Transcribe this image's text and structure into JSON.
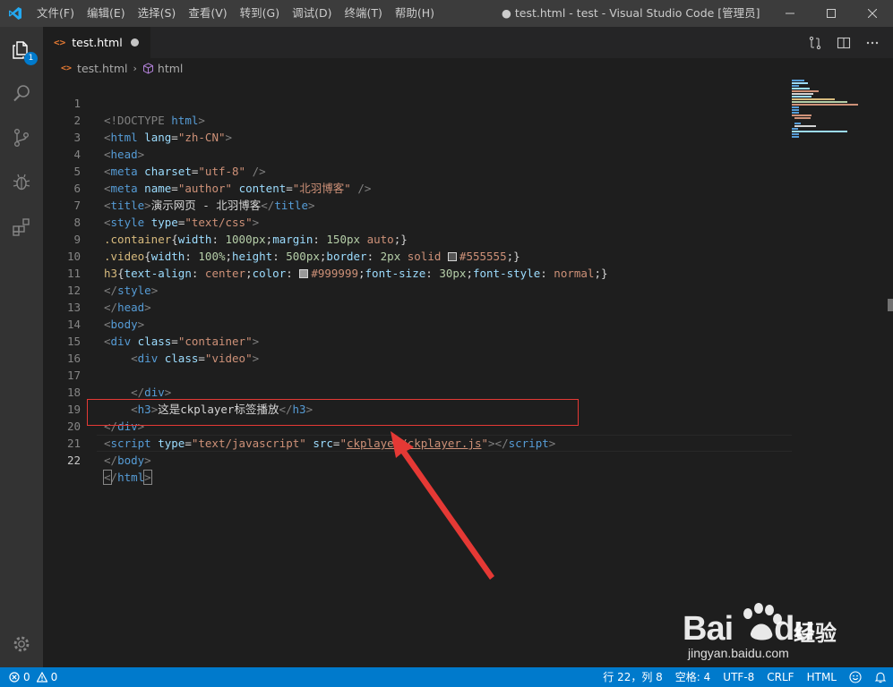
{
  "titlebar": {
    "menu": [
      "文件(F)",
      "编辑(E)",
      "选择(S)",
      "查看(V)",
      "转到(G)",
      "调试(D)",
      "终端(T)",
      "帮助(H)"
    ],
    "window_title": "● test.html - test - Visual Studio Code [管理员]"
  },
  "activitybar": {
    "explorer_badge": "1"
  },
  "tab": {
    "icon": "<>",
    "label": "test.html"
  },
  "breadcrumb": {
    "file_icon": "<>",
    "file": "test.html",
    "element": "html"
  },
  "editor": {
    "line_numbers": [
      "1",
      "2",
      "3",
      "4",
      "5",
      "6",
      "7",
      "8",
      "9",
      "10",
      "11",
      "12",
      "13",
      "14",
      "15",
      "16",
      "17",
      "18",
      "19",
      "20",
      "21",
      "22"
    ],
    "active_line": "22",
    "code": {
      "l1_a": "<!DOCTYPE ",
      "l1_b": "html",
      "l1_c": ">",
      "l2_tag": "html",
      "l2_attr": "lang",
      "l2_val": "\"zh-CN\"",
      "l3_tag": "head",
      "l4_tag": "meta",
      "l4_attr": "charset",
      "l4_val": "\"utf-8\"",
      "l5_tag": "meta",
      "l5_attr1": "name",
      "l5_val1": "\"author\"",
      "l5_attr2": "content",
      "l5_val2": "\"北羽博客\"",
      "l6_tag": "title",
      "l6_text": "演示网页 - 北羽博客",
      "l6_end": "title",
      "l7_tag": "style",
      "l7_attr": "type",
      "l7_val": "\"text/css\"",
      "l8_sel": ".container",
      "l8_p1": "width",
      "l8_v1": "1000px",
      "l8_p2": "margin",
      "l8_v2": "150px",
      "l8_v3": "auto",
      "l9_sel": ".video",
      "l9_p1": "width",
      "l9_v1": "100%",
      "l9_p2": "height",
      "l9_v2": "500px",
      "l9_p3": "border",
      "l9_v3": "2px",
      "l9_v4": "solid",
      "l9_v5": "#555555",
      "l10_sel": "h3",
      "l10_p1": "text-align",
      "l10_v1": "center",
      "l10_p2": "color",
      "l10_v2": "#999999",
      "l10_p3": "font-size",
      "l10_v3": "30px",
      "l10_p4": "font-style",
      "l10_v4": "normal",
      "l11_tag": "style",
      "l12_tag": "head",
      "l13_tag": "body",
      "l14_tag": "div",
      "l14_attr": "class",
      "l14_val": "\"container\"",
      "l15_tag": "div",
      "l15_attr": "class",
      "l15_val": "\"video\"",
      "l17_tag": "div",
      "l18_tag": "h3",
      "l18_text": "这是ckplayer标签播放",
      "l18_end": "h3",
      "l19_tag": "div",
      "l20_tag": "script",
      "l20_attr1": "type",
      "l20_val1": "\"text/javascript\"",
      "l20_attr2": "src",
      "l20_q1": "\"",
      "l20_link": "ckplayer/ckplayer.js",
      "l20_q2": "\"",
      "l20_end": "script",
      "l21_tag": "body",
      "l22_tag": "html"
    },
    "swatch_colors": {
      "c555": "#555555",
      "c999": "#999999"
    }
  },
  "watermark": {
    "brand": "Bai",
    "brand_du": "du",
    "product": "经验",
    "url": "jingyan.baidu.com"
  },
  "statusbar": {
    "errors": "0",
    "warnings": "0",
    "position": "行 22，列 8",
    "spaces": "空格: 4",
    "encoding": "UTF-8",
    "eol": "CRLF",
    "language": "HTML"
  },
  "colors": {
    "accent": "#007acc",
    "annotation": "#e53935",
    "editor_bg": "#1e1e1e"
  }
}
